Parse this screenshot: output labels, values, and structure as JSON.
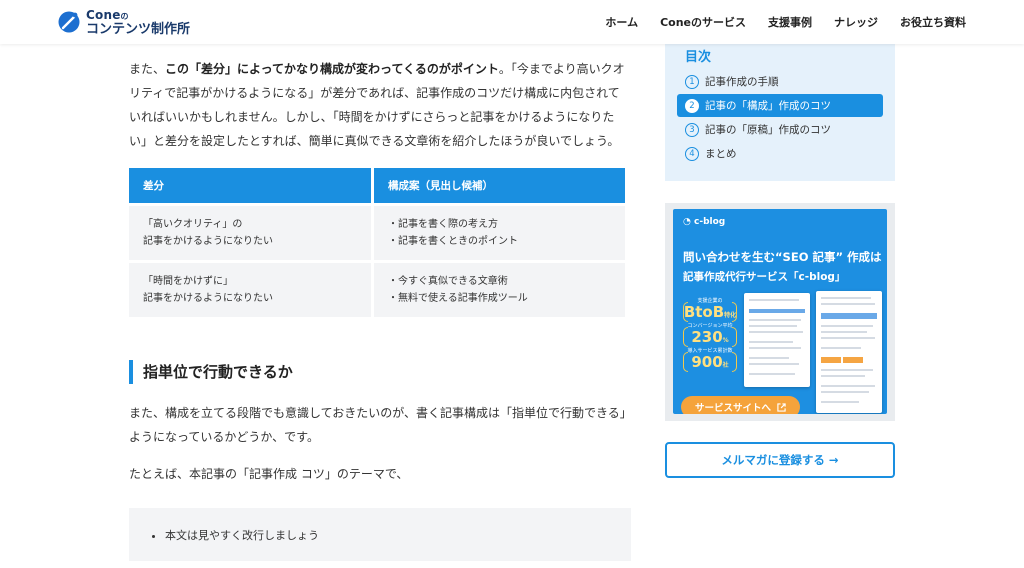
{
  "header": {
    "logo_top": "Cone",
    "logo_top_small": "の",
    "logo_bottom": "コンテンツ制作所",
    "nav": [
      "ホーム",
      "Coneのサービス",
      "支援事例",
      "ナレッジ",
      "お役立ち資料"
    ]
  },
  "article": {
    "p1_a": "また、",
    "p1_bold": "この「差分」によってかなり構成が変わってくるのがポイント",
    "p1_b": "。「今までより高いクオリティで記事がかけるようになる」が差分であれば、記事作成のコツだけ構成に内包されていればいいかもしれません。しかし、「時間をかけずにさらっと記事をかけるようになりたい」と差分を設定したとすれば、簡単に真似できる文章術を紹介したほうが良いでしょう。",
    "table": {
      "headers": [
        "差分",
        "構成案（見出し候補）"
      ],
      "rows": [
        {
          "diff": [
            "「高いクオリティ」の",
            "記事をかけるようになりたい"
          ],
          "plan": [
            "・記事を書く際の考え方",
            "・記事を書くときのポイント"
          ]
        },
        {
          "diff": [
            "「時間をかけずに」",
            "記事をかけるようになりたい"
          ],
          "plan": [
            "・今すぐ真似できる文章術",
            "・無料で使える記事作成ツール"
          ]
        }
      ]
    },
    "h3": "指単位で行動できるか",
    "p2": "また、構成を立てる段階でも意識しておきたいのが、書く記事構成は「指単位で行動できる」ようになっているかどうか、です。",
    "p3": "たとえば、本記事の「記事作成 コツ」のテーマで、",
    "bullet": "本文は見やすく改行しましょう"
  },
  "toc": {
    "title": "目次",
    "items": [
      {
        "num": "1",
        "label": "記事作成の手順"
      },
      {
        "num": "2",
        "label": "記事の「構成」作成のコツ"
      },
      {
        "num": "3",
        "label": "記事の「原稿」作成のコツ"
      },
      {
        "num": "4",
        "label": "まとめ"
      }
    ],
    "active_index": 1
  },
  "banner": {
    "brand": "c-blog",
    "headline1": "問い合わせを生む“SEO 記事” 作成は",
    "headline2": "記事作成代行サービス「c-blog」",
    "stats": [
      {
        "caption": "支援企業の",
        "value": "BtoB",
        "unit": "特化"
      },
      {
        "caption": "コンバージョン平均",
        "value": "230",
        "unit": "%"
      },
      {
        "caption": "導入サービス累計数",
        "value": "900",
        "unit": "社"
      }
    ],
    "cta": "サービスサイトへ"
  },
  "newsletter": {
    "label": "メルマガに登録する",
    "arrow": "→"
  },
  "colors": {
    "accent": "#1a8fe0",
    "toc_bg": "#e5f1fb",
    "cell_bg": "#f3f4f6",
    "orange": "#f5a33b"
  }
}
